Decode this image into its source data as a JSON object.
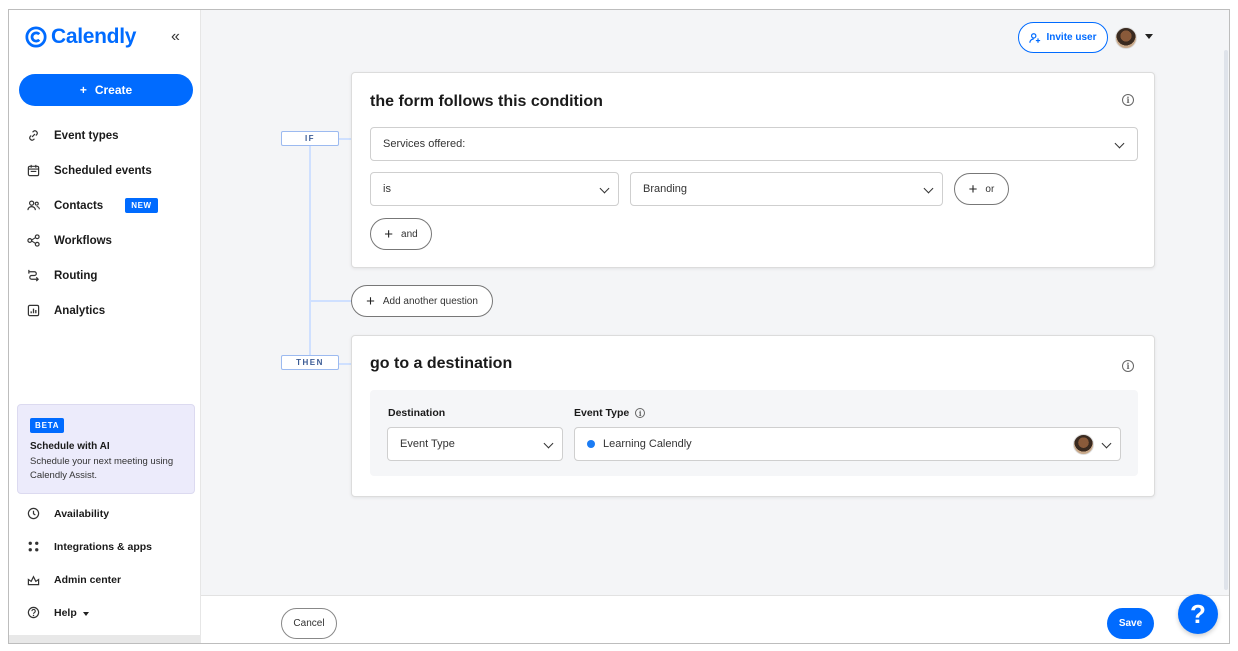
{
  "app": {
    "brand": "Calendly",
    "collapse_label": "«"
  },
  "sidebar": {
    "create_label": "Create",
    "items": [
      {
        "label": "Event types",
        "icon": "link-icon"
      },
      {
        "label": "Scheduled events",
        "icon": "calendar-icon"
      },
      {
        "label": "Contacts",
        "icon": "contacts-icon",
        "badge": "NEW"
      },
      {
        "label": "Workflows",
        "icon": "workflows-icon"
      },
      {
        "label": "Routing",
        "icon": "routing-icon"
      },
      {
        "label": "Analytics",
        "icon": "analytics-icon"
      }
    ],
    "ai_card": {
      "badge": "BETA",
      "title": "Schedule with AI",
      "description": "Schedule your next meeting using Calendly Assist."
    },
    "bottom_items": [
      {
        "label": "Availability",
        "icon": "clock-icon"
      },
      {
        "label": "Integrations & apps",
        "icon": "apps-grid-icon"
      },
      {
        "label": "Admin center",
        "icon": "admin-icon"
      },
      {
        "label": "Help",
        "icon": "help-icon"
      }
    ]
  },
  "header": {
    "invite_label": "Invite user"
  },
  "flow": {
    "if_tag": "IF",
    "then_tag": "THEN",
    "add_question_label": "Add another question"
  },
  "condition_card": {
    "title": "the form follows this condition",
    "question_select": "Services offered:",
    "operator_select": "is",
    "value_select": "Branding",
    "or_label": "or",
    "and_label": "and"
  },
  "destination_card": {
    "title": "go to a destination",
    "destination_label": "Destination",
    "destination_value": "Event Type",
    "event_type_label": "Event Type",
    "event_type_value": "Learning Calendly"
  },
  "footer": {
    "cancel_label": "Cancel",
    "save_label": "Save"
  },
  "help_fab": "?",
  "colors": {
    "primary": "#006bff",
    "badge_bg": "#006bff",
    "ai_card_bg": "#ecebfb"
  }
}
